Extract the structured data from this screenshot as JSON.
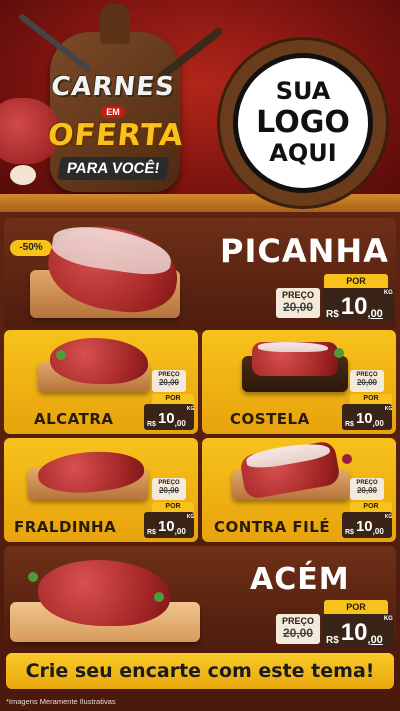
{
  "header": {
    "title_line1": "CARNES",
    "title_em": "EM",
    "title_line2": "OFERTA",
    "title_line3": "PARA VOCÊ!",
    "logo_line1": "SUA",
    "logo_line2": "LOGO",
    "logo_line3": "AQUI"
  },
  "currency": "R$",
  "unit": "KG",
  "por_label": "POR",
  "preco_label": "PREÇO",
  "products": [
    {
      "name": "PICANHA",
      "discount": "-50%",
      "old_price": "20,00",
      "price_int": "10",
      "price_dec": "00"
    },
    {
      "name": "ALCATRA",
      "old_price": "20,00",
      "price_int": "10",
      "price_dec": "00"
    },
    {
      "name": "COSTELA",
      "old_price": "20,00",
      "price_int": "10",
      "price_dec": "00"
    },
    {
      "name": "FRALDINHA",
      "old_price": "20,00",
      "price_int": "10",
      "price_dec": "00"
    },
    {
      "name": "CONTRA FILÉ",
      "old_price": "20,00",
      "price_int": "10",
      "price_dec": "00"
    },
    {
      "name": "ACÉM",
      "old_price": "20,00",
      "price_int": "10",
      "price_dec": "00"
    }
  ],
  "cta": "Crie seu encarte com este tema!",
  "footnote": "*Imagens Meramente Ilustrativas",
  "colors": {
    "yellow": "#f7c21c",
    "brown": "#5e2412",
    "red": "#9e1a12",
    "dark": "#3a2417"
  }
}
